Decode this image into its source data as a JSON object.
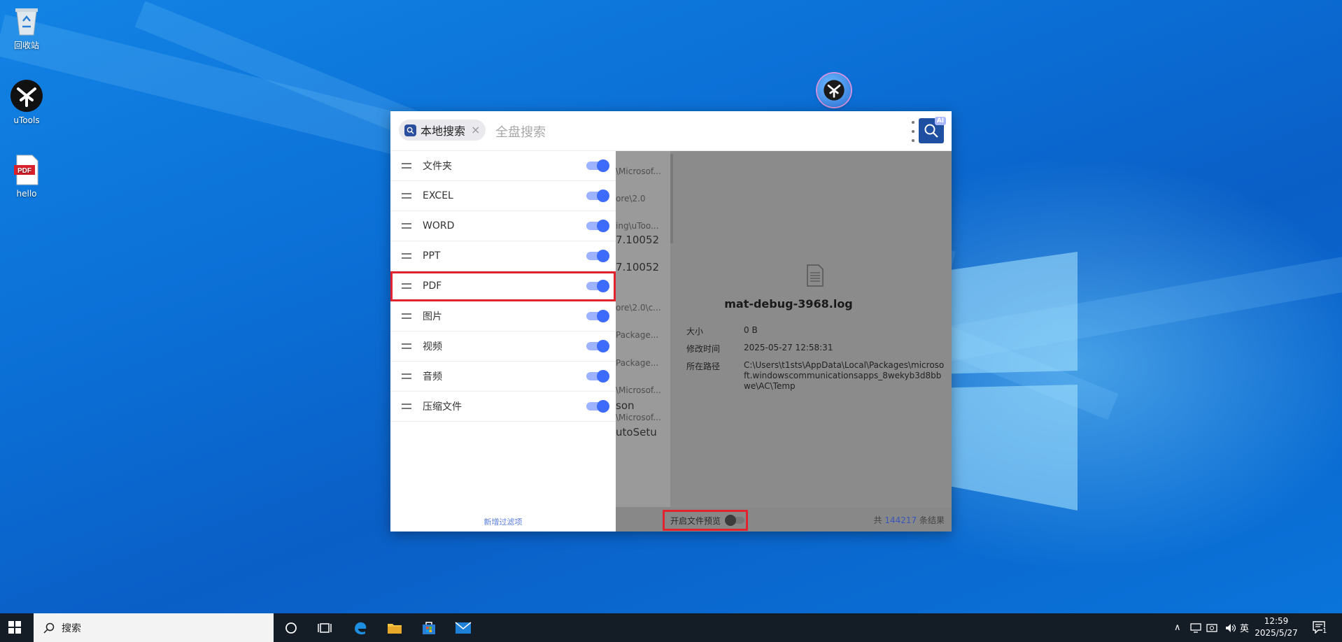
{
  "desktop": {
    "icons": [
      {
        "label": "回收站",
        "icon": "recycle-bin-icon"
      },
      {
        "label": "uTools",
        "icon": "utools-icon"
      },
      {
        "label": "hello",
        "icon": "pdf-file-icon",
        "badge": "PDF"
      }
    ]
  },
  "app": {
    "scope_chip": "本地搜索",
    "search_placeholder": "全盘搜索",
    "ai_badge": "AI",
    "filters": [
      {
        "label": "文件夹",
        "enabled": true
      },
      {
        "label": "EXCEL",
        "enabled": true
      },
      {
        "label": "WORD",
        "enabled": true
      },
      {
        "label": "PPT",
        "enabled": true
      },
      {
        "label": "PDF",
        "enabled": true
      },
      {
        "label": "图片",
        "enabled": true
      },
      {
        "label": "视频",
        "enabled": true
      },
      {
        "label": "音频",
        "enabled": true
      },
      {
        "label": "压缩文件",
        "enabled": true
      }
    ],
    "add_filter": "新增过滤项",
    "result_fragments": [
      {
        "text": "\\Microsof...",
        "big": false
      },
      {
        "text": "ore\\2.0",
        "big": false
      },
      {
        "text": "ing\\uToo...",
        "big": false
      },
      {
        "text": "7.10052",
        "big": true
      },
      {
        "text": "7.10052",
        "big": true
      },
      {
        "text": "ore\\2.0\\c...",
        "big": false
      },
      {
        "text": "Package...",
        "big": false
      },
      {
        "text": "Package...",
        "big": false
      },
      {
        "text": "\\Microsof...",
        "big": false
      },
      {
        "text": "son",
        "big": true
      },
      {
        "text": "\\Microsof...",
        "big": false
      },
      {
        "text": "utoSetu",
        "big": true
      }
    ],
    "preview": {
      "file_name": "mat-debug-3968.log",
      "size_label": "大小",
      "size_value": "0 B",
      "modified_label": "修改时间",
      "modified_value": "2025-05-27 12:58:31",
      "path_label": "所在路径",
      "path_value": "C:\\Users\\t1sts\\AppData\\Local\\Packages\\microsoft.windowscommunicationsapps_8wekyb3d8bbwe\\AC\\Temp"
    },
    "status": {
      "preview_toggle_label": "开启文件预览",
      "preview_enabled": false,
      "count_prefix": "共",
      "count_value": "144217",
      "count_suffix": "条结果"
    }
  },
  "taskbar": {
    "search_placeholder": "搜索",
    "ime": "英",
    "time": "12:59",
    "date": "2025/5/27",
    "notification_count": "1"
  },
  "colors": {
    "accent": "#3d6bfc",
    "highlight_box": "#e0232e",
    "search_button": "#1f4fa0"
  }
}
